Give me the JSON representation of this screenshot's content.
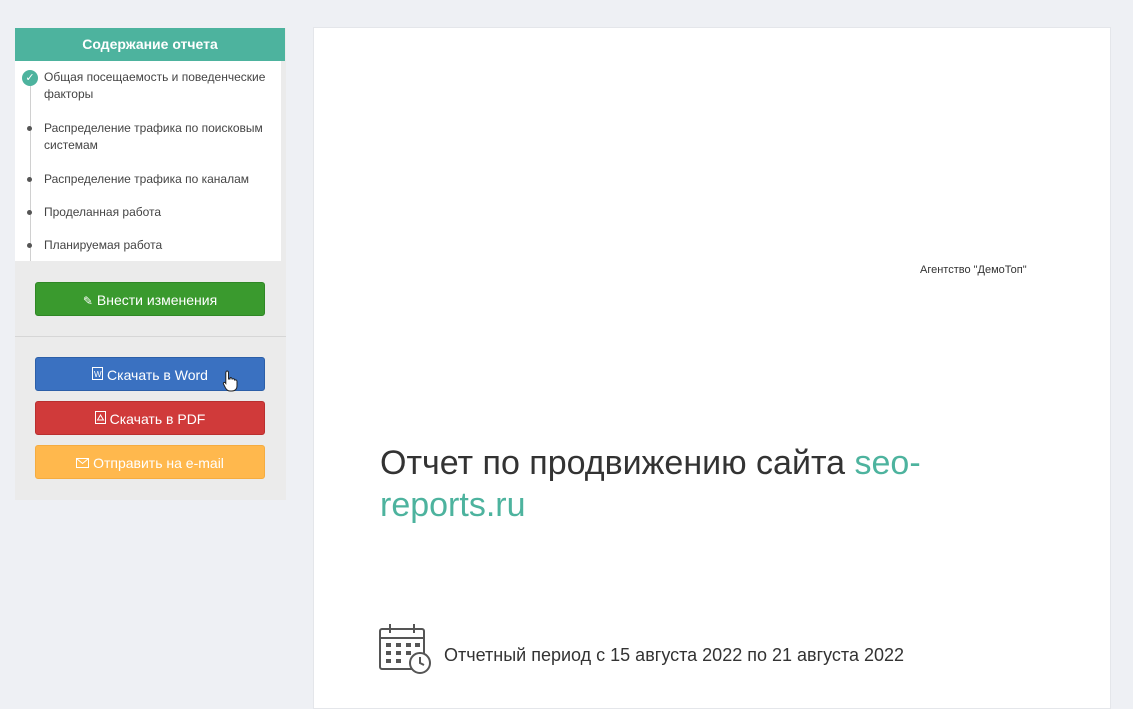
{
  "toc": {
    "title": "Содержание отчета",
    "items": [
      {
        "label": "Общая посещаемость и поведенческие факторы",
        "done": true
      },
      {
        "label": "Распределение трафика по поисковым системам",
        "done": false
      },
      {
        "label": "Распределение трафика по каналам",
        "done": false
      },
      {
        "label": "Проделанная работа",
        "done": false
      },
      {
        "label": "Планируемая работа",
        "done": false
      }
    ]
  },
  "buttons": {
    "edit": "Внести изменения",
    "word": "Скачать в Word",
    "pdf": "Скачать в PDF",
    "email": "Отправить на e-mail"
  },
  "report": {
    "agency": "Агентство \"ДемоТоп\"",
    "title_prefix": "Отчет по продвижению сайта ",
    "site": "seo-reports.ru",
    "period": "Отчетный период с 15 августа 2022 по 21 августа 2022"
  },
  "colors": {
    "accent": "#4db39e",
    "edit_button": "#3a9a2e",
    "word_button": "#3a71c1",
    "pdf_button": "#d03a3a",
    "email_button": "#ffb84d"
  }
}
